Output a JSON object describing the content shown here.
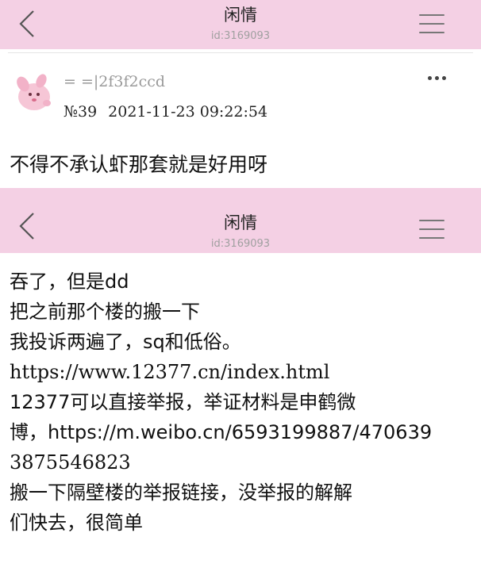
{
  "header_top": {
    "title": "闲情",
    "id_text": "id:3169093"
  },
  "post": {
    "username": "= =|2f3f2ccd",
    "floor": "№39",
    "datetime": "2021-11-23 09:22:54",
    "text": "不得不承认虾那套就是好用呀"
  },
  "header_embedded": {
    "title": "闲情",
    "id_text": "id:3169093"
  },
  "embedded_content": {
    "lines": [
      "吞了，但是dd",
      "把之前那个楼的搬一下",
      "我投诉两遍了，sq和低俗。",
      "https://www.12377.cn/index.html",
      "12377可以直接举报，举证材料是申鹤微",
      "博，https://m.weibo.cn/6593199887/470639",
      "3875546823",
      "搬一下隔壁楼的举报链接，没举报的解解",
      "们快去，很简单"
    ]
  },
  "icons": [
    "back-icon",
    "menu-icon",
    "avatar",
    "more-icon"
  ],
  "colors": {
    "header_bg": "#f4d0e4",
    "username": "#9a9a9a",
    "id_text": "#a0a0a0"
  }
}
